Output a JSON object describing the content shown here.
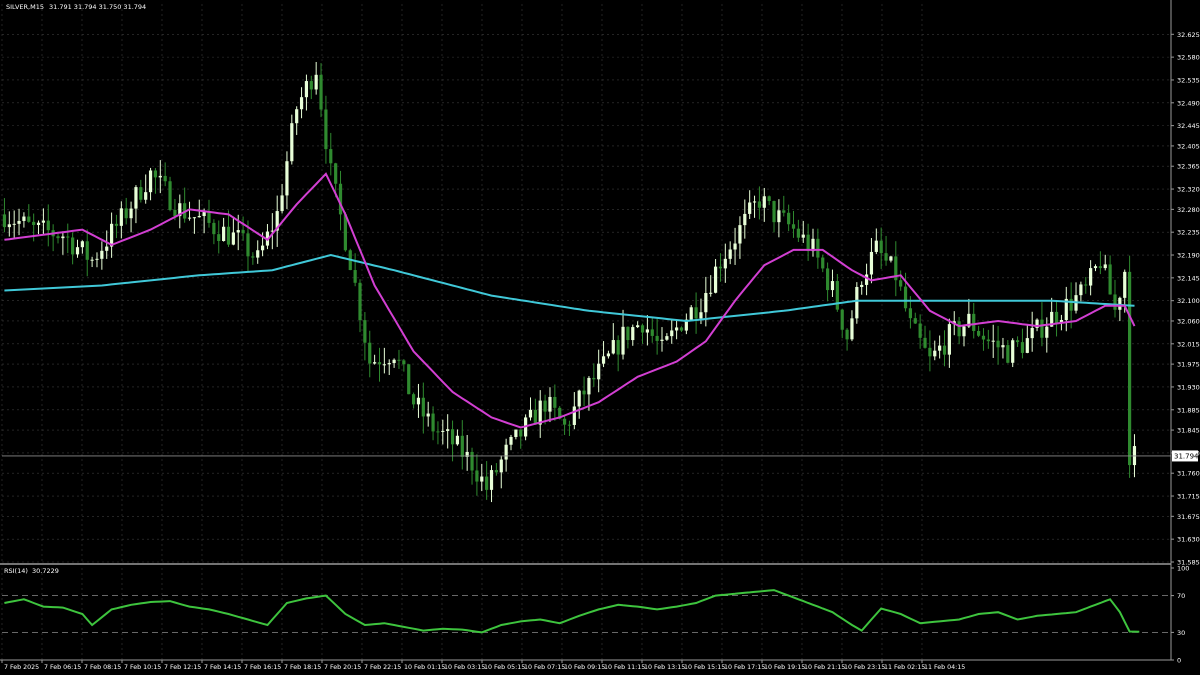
{
  "header": {
    "symbol_label": "SILVER,M15",
    "ohlc": "31.791 31.794 31.750 31.794"
  },
  "rsi_header": {
    "label": "RSI(14)",
    "value": "30.7229"
  },
  "colors": {
    "background": "#000000",
    "grid": "#3a3a3a",
    "bull_candle": "#e8ffd8",
    "bear_candle": "#2f8a2f",
    "ma_fast": "#d23fd2",
    "ma_slow": "#40c8d8",
    "rsi_line": "#3ec43e",
    "axis_text": "#ffffff",
    "price_marker": "#ffffff"
  },
  "chart_data": [
    {
      "type": "candlestick",
      "ylim": [
        31.585,
        32.665
      ],
      "yticks": [
        "32.625",
        "32.580",
        "32.535",
        "32.490",
        "32.445",
        "32.405",
        "32.365",
        "32.320",
        "32.280",
        "32.235",
        "32.190",
        "32.145",
        "32.100",
        "32.060",
        "32.015",
        "31.975",
        "31.930",
        "31.885",
        "31.845",
        "31.800",
        "31.760",
        "31.715",
        "31.675",
        "31.630",
        "31.585"
      ],
      "current_price": "31.794",
      "xticks": [
        "7 Feb 2025",
        "7 Feb 06:15",
        "7 Feb 08:15",
        "7 Feb 10:15",
        "7 Feb 12:15",
        "7 Feb 14:15",
        "7 Feb 16:15",
        "7 Feb 18:15",
        "7 Feb 20:15",
        "7 Feb 22:15",
        "10 Feb 01:15",
        "10 Feb 03:15",
        "10 Feb 05:15",
        "10 Feb 07:15",
        "10 Feb 09:15",
        "10 Feb 11:15",
        "10 Feb 13:15",
        "10 Feb 15:15",
        "10 Feb 17:15",
        "10 Feb 19:15",
        "10 Feb 21:15",
        "10 Feb 23:15",
        "11 Feb 02:15",
        "11 Feb 04:15"
      ],
      "close_keypoints": [
        [
          0,
          32.27
        ],
        [
          6,
          32.24
        ],
        [
          12,
          32.23
        ],
        [
          18,
          32.18
        ],
        [
          24,
          32.26
        ],
        [
          30,
          32.35
        ],
        [
          36,
          32.28
        ],
        [
          42,
          32.25
        ],
        [
          48,
          32.22
        ],
        [
          52,
          32.18
        ],
        [
          56,
          32.27
        ],
        [
          60,
          32.48
        ],
        [
          64,
          32.56
        ],
        [
          67,
          32.35
        ],
        [
          71,
          32.18
        ],
        [
          75,
          31.98
        ],
        [
          80,
          32.0
        ],
        [
          84,
          31.9
        ],
        [
          88,
          31.85
        ],
        [
          92,
          31.82
        ],
        [
          96,
          31.78
        ],
        [
          99,
          31.73
        ],
        [
          103,
          31.8
        ],
        [
          107,
          31.85
        ],
        [
          111,
          31.9
        ],
        [
          115,
          31.85
        ],
        [
          119,
          31.92
        ],
        [
          123,
          31.97
        ],
        [
          127,
          32.03
        ],
        [
          131,
          32.06
        ],
        [
          135,
          32.0
        ],
        [
          139,
          32.06
        ],
        [
          143,
          32.1
        ],
        [
          147,
          32.18
        ],
        [
          151,
          32.24
        ],
        [
          155,
          32.3
        ],
        [
          158,
          32.27
        ],
        [
          162,
          32.24
        ],
        [
          166,
          32.2
        ],
        [
          170,
          32.12
        ],
        [
          173,
          32.03
        ],
        [
          176,
          32.15
        ],
        [
          179,
          32.2
        ],
        [
          183,
          32.15
        ],
        [
          186,
          32.05
        ],
        [
          190,
          31.98
        ],
        [
          194,
          32.03
        ],
        [
          198,
          32.06
        ],
        [
          202,
          32.02
        ],
        [
          206,
          32.0
        ],
        [
          210,
          32.02
        ],
        [
          214,
          32.06
        ],
        [
          218,
          32.09
        ],
        [
          222,
          32.12
        ],
        [
          225,
          32.18
        ],
        [
          228,
          32.08
        ],
        [
          230,
          32.16
        ],
        [
          231,
          31.8
        ],
        [
          232,
          31.794
        ]
      ],
      "series": [
        {
          "name": "",
          "kind": "ma_fast",
          "points": [
            [
              0,
              32.22
            ],
            [
              8,
              32.23
            ],
            [
              16,
              32.24
            ],
            [
              22,
              32.21
            ],
            [
              30,
              32.24
            ],
            [
              38,
              32.28
            ],
            [
              46,
              32.27
            ],
            [
              54,
              32.22
            ],
            [
              60,
              32.29
            ],
            [
              66,
              32.35
            ],
            [
              70,
              32.27
            ],
            [
              76,
              32.13
            ],
            [
              84,
              32.0
            ],
            [
              92,
              31.92
            ],
            [
              100,
              31.87
            ],
            [
              106,
              31.85
            ],
            [
              114,
              31.87
            ],
            [
              122,
              31.9
            ],
            [
              130,
              31.95
            ],
            [
              138,
              31.98
            ],
            [
              144,
              32.02
            ],
            [
              150,
              32.1
            ],
            [
              156,
              32.17
            ],
            [
              162,
              32.2
            ],
            [
              168,
              32.2
            ],
            [
              174,
              32.16
            ],
            [
              178,
              32.14
            ],
            [
              184,
              32.15
            ],
            [
              190,
              32.08
            ],
            [
              196,
              32.05
            ],
            [
              204,
              32.06
            ],
            [
              212,
              32.05
            ],
            [
              220,
              32.06
            ],
            [
              226,
              32.09
            ],
            [
              230,
              32.09
            ],
            [
              232,
              32.05
            ]
          ]
        },
        {
          "name": "",
          "kind": "ma_slow",
          "points": [
            [
              0,
              32.12
            ],
            [
              20,
              32.13
            ],
            [
              40,
              32.15
            ],
            [
              55,
              32.16
            ],
            [
              67,
              32.19
            ],
            [
              80,
              32.16
            ],
            [
              100,
              32.11
            ],
            [
              120,
              32.08
            ],
            [
              140,
              32.06
            ],
            [
              160,
              32.08
            ],
            [
              175,
              32.1
            ],
            [
              195,
              32.1
            ],
            [
              215,
              32.1
            ],
            [
              232,
              32.09
            ]
          ]
        }
      ]
    },
    {
      "type": "line",
      "title": "RSI(14)",
      "ylim": [
        0,
        100
      ],
      "yticks": [
        "100",
        "70",
        "30",
        "0"
      ],
      "levels": [
        70,
        30
      ],
      "series": [
        {
          "name": "",
          "points": [
            [
              0,
              62
            ],
            [
              4,
              66
            ],
            [
              8,
              58
            ],
            [
              12,
              57
            ],
            [
              16,
              50
            ],
            [
              18,
              38
            ],
            [
              22,
              55
            ],
            [
              26,
              60
            ],
            [
              30,
              63
            ],
            [
              34,
              64
            ],
            [
              38,
              58
            ],
            [
              42,
              55
            ],
            [
              46,
              50
            ],
            [
              50,
              44
            ],
            [
              54,
              38
            ],
            [
              58,
              62
            ],
            [
              62,
              67
            ],
            [
              66,
              70
            ],
            [
              70,
              50
            ],
            [
              74,
              38
            ],
            [
              78,
              40
            ],
            [
              82,
              36
            ],
            [
              86,
              32
            ],
            [
              90,
              34
            ],
            [
              94,
              33
            ],
            [
              98,
              30
            ],
            [
              102,
              38
            ],
            [
              106,
              42
            ],
            [
              110,
              44
            ],
            [
              114,
              40
            ],
            [
              118,
              48
            ],
            [
              122,
              55
            ],
            [
              126,
              60
            ],
            [
              130,
              58
            ],
            [
              134,
              55
            ],
            [
              138,
              58
            ],
            [
              142,
              62
            ],
            [
              146,
              70
            ],
            [
              150,
              72
            ],
            [
              154,
              74
            ],
            [
              158,
              76
            ],
            [
              162,
              68
            ],
            [
              166,
              60
            ],
            [
              170,
              52
            ],
            [
              174,
              38
            ],
            [
              176,
              32
            ],
            [
              180,
              56
            ],
            [
              184,
              50
            ],
            [
              188,
              40
            ],
            [
              192,
              42
            ],
            [
              196,
              44
            ],
            [
              200,
              50
            ],
            [
              204,
              52
            ],
            [
              208,
              44
            ],
            [
              212,
              48
            ],
            [
              216,
              50
            ],
            [
              220,
              52
            ],
            [
              224,
              60
            ],
            [
              227,
              66
            ],
            [
              229,
              52
            ],
            [
              231,
              31
            ],
            [
              233,
              30.7
            ]
          ]
        }
      ]
    }
  ]
}
